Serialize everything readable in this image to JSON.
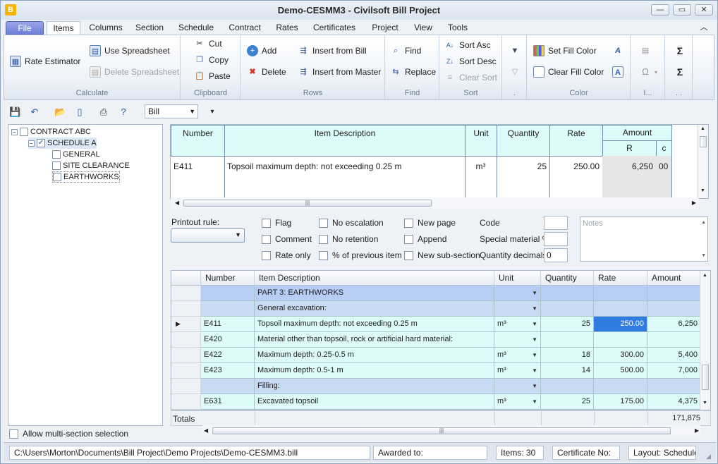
{
  "window": {
    "title": "Demo-CESMM3 - Civilsoft Bill Project",
    "app_icon": "B"
  },
  "tabs": [
    "File",
    "Items",
    "Columns",
    "Section",
    "Schedule",
    "Contract",
    "Rates",
    "Certificates",
    "Project",
    "View",
    "Tools"
  ],
  "ribbon": {
    "calculate": {
      "label": "Calculate",
      "rate_estimator": "Rate Estimator",
      "use_spreadsheet": "Use Spreadsheet",
      "delete_spreadsheet": "Delete Spreadsheet"
    },
    "clipboard": {
      "label": "Clipboard",
      "cut": "Cut",
      "copy": "Copy",
      "paste": "Paste"
    },
    "rows": {
      "label": "Rows",
      "add": "Add",
      "delete": "Delete",
      "insert_from_bill": "Insert from Bill",
      "insert_from_master": "Insert from Master"
    },
    "find": {
      "label": "Find",
      "find": "Find",
      "replace": "Replace"
    },
    "sort": {
      "label": "Sort",
      "sort_asc": "Sort Asc",
      "sort_desc": "Sort Desc",
      "clear_sort": "Clear Sort"
    },
    "filter": {
      "label": "."
    },
    "color": {
      "label": "Color",
      "set_fill": "Set Fill Color",
      "clear_fill": "Clear Fill Color"
    },
    "insert": {
      "label": "I..."
    },
    "sum": {
      "label": ". ."
    }
  },
  "toolbar": {
    "bill_combo": "Bill"
  },
  "tree": {
    "contract": "CONTRACT ABC",
    "schedule": "SCHEDULE A",
    "sections": [
      "GENERAL",
      "SITE CLEARANCE",
      "EARTHWORKS"
    ]
  },
  "multi_section": "Allow multi-section selection",
  "upper_grid": {
    "headers": {
      "number": "Number",
      "description": "Item Description",
      "unit": "Unit",
      "quantity": "Quantity",
      "rate": "Rate",
      "amount": "Amount",
      "amount_r": "R",
      "amount_c": "c"
    },
    "row": {
      "number": "E411",
      "description": "Topsoil maximum depth: not exceeding 0.25 m",
      "unit": "m³",
      "quantity": "25",
      "rate": "250.00",
      "amount_r": "6,250",
      "amount_c": "00"
    }
  },
  "options": {
    "printout_rule": "Printout rule:",
    "flag": "Flag",
    "comment": "Comment",
    "rate_only": "Rate only",
    "no_escalation": "No escalation",
    "no_retention": "No retention",
    "pct_previous": "% of previous item",
    "new_page": "New page",
    "append": "Append",
    "new_subsection": "New sub-section",
    "code": "Code",
    "special_material": "Special material %",
    "quantity_decimals": "Quantity decimals",
    "quantity_decimals_value": "0",
    "notes_placeholder": "Notes"
  },
  "lower_grid": {
    "headers": [
      "Number",
      "Item Description",
      "Unit",
      "Quantity",
      "Rate",
      "Amount"
    ],
    "rows": [
      {
        "number": "",
        "description": "PART 3: EARTHWORKS",
        "unit": "",
        "quantity": "",
        "rate": "",
        "amount": "",
        "kind": "part"
      },
      {
        "number": "",
        "description": "General excavation:",
        "unit": "",
        "quantity": "",
        "rate": "",
        "amount": "",
        "kind": "heading"
      },
      {
        "number": "E411",
        "description": "Topsoil maximum depth: not exceeding 0.25 m",
        "unit": "m³",
        "quantity": "25",
        "rate": "250.00",
        "amount": "6,250",
        "kind": "current"
      },
      {
        "number": "E420",
        "description": "Material other than topsoil, rock or artificial hard material:",
        "unit": "",
        "quantity": "",
        "rate": "",
        "amount": "",
        "kind": "plain"
      },
      {
        "number": "E422",
        "description": "Maximum depth: 0.25-0.5 m",
        "unit": "m³",
        "quantity": "18",
        "rate": "300.00",
        "amount": "5,400",
        "kind": "item"
      },
      {
        "number": "E423",
        "description": "Maximum depth: 0.5-1 m",
        "unit": "m³",
        "quantity": "14",
        "rate": "500.00",
        "amount": "7,000",
        "kind": "item"
      },
      {
        "number": "",
        "description": "Filling:",
        "unit": "",
        "quantity": "",
        "rate": "",
        "amount": "",
        "kind": "heading"
      },
      {
        "number": "E631",
        "description": "Excavated topsoil",
        "unit": "m³",
        "quantity": "25",
        "rate": "175.00",
        "amount": "4,375",
        "kind": "item"
      }
    ],
    "totals_label": "Totals",
    "totals_amount": "171,875"
  },
  "status": {
    "path": "C:\\Users\\Morton\\Documents\\Bill Project\\Demo Projects\\Demo-CESMM3.bill",
    "awarded_to": "Awarded to:",
    "items": "Items: 30",
    "certificate_no": "Certificate No:",
    "layout": "Layout: Schedule"
  }
}
